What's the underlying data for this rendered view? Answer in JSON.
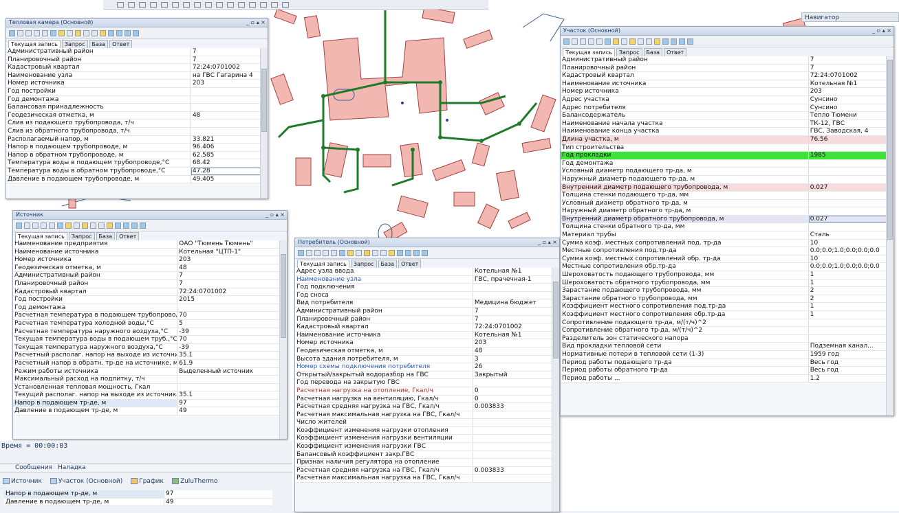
{
  "navigator_title": "Навигатор",
  "tabs": {
    "current": "Текущая запись",
    "query": "Запрос",
    "base": "База",
    "answer": "Ответ"
  },
  "win_controls": "_ ▫ ▴ ×",
  "heat_chamber": {
    "title": "Тепловая камера (Основной)",
    "rows": [
      [
        "Административный район",
        "7"
      ],
      [
        "Планировочный район",
        "7"
      ],
      [
        "Кадастровый квартал",
        "72:24:0701002"
      ],
      [
        "Наименование узла",
        "на ГВС Гагарина 4"
      ],
      [
        "Номер источника",
        "203"
      ],
      [
        "Год постройки",
        ""
      ],
      [
        "Год демонтажа",
        ""
      ],
      [
        "Балансовая принадлежность",
        ""
      ],
      [
        "Геодезическая отметка, м",
        "48"
      ],
      [
        "Слив из подающего трубопровода, т/ч",
        ""
      ],
      [
        "Слив из обратного трубопровода, т/ч",
        ""
      ],
      [
        "Располагаемый напор, м",
        "33.821"
      ],
      [
        "Напор в подающем трубопроводе, м",
        "96.406"
      ],
      [
        "Напор в обратном трубопроводе, м",
        "62.585"
      ],
      [
        "Температура воды в подающем трубопроводе,°С",
        "68.42"
      ],
      [
        "Температура воды в обратном трубопроводе,°С",
        "47.28"
      ],
      [
        "Давление в подающем трубопроводе, м",
        "49.405"
      ]
    ]
  },
  "source": {
    "title": "Источник",
    "rows": [
      [
        "Наименование предприятия",
        "ОАО \"Тюмень Тюмень\""
      ],
      [
        "Наименование источника",
        "Котельная \"ЦТП-1\""
      ],
      [
        "Номер источника",
        "203"
      ],
      [
        "Геодезическая отметка, м",
        "48"
      ],
      [
        "Административный район",
        "7"
      ],
      [
        "Планировочный район",
        "7"
      ],
      [
        "Кадастровый квартал",
        "72:24:0701002"
      ],
      [
        "Год постройки",
        "2015"
      ],
      [
        "Год демонтажа",
        ""
      ],
      [
        "Расчетная температура в подающем трубопроводе,°С",
        "70"
      ],
      [
        "Расчетная температура холодной воды,°С",
        "5"
      ],
      [
        "Расчетная температура наружного воздуха,°С",
        "-39"
      ],
      [
        "Текущая температура воды в подающем труб.,°С",
        "70"
      ],
      [
        "Текущая температура наружного воздуха,°С",
        "-39"
      ],
      [
        "Расчетный располаг. напор на выходе из источника, м",
        "35.1"
      ],
      [
        "Расчетный напор в обратн. тр-де на источнике, м",
        "61.9"
      ],
      [
        "Режим работы источника",
        "Выделенный источник"
      ],
      [
        "Максимальный расход на подпитку, т/ч",
        ""
      ],
      [
        "Установленная тепловая мощность, Гкал",
        ""
      ],
      [
        "Текущий располаг. напор на выходе из источника, м",
        "35.1"
      ],
      [
        "Напор в подающем тр-де, м",
        "97"
      ],
      [
        "Давление в подающем тр-де, м",
        "49"
      ]
    ]
  },
  "consumer": {
    "title": "Потребитель (Основной)",
    "rows": [
      [
        "Адрес узла ввода",
        "Котельная №1"
      ],
      [
        "Наименование узла",
        "ГВС, прачечная-1"
      ],
      [
        "Год подключения",
        ""
      ],
      [
        "Год сноса",
        ""
      ],
      [
        "Вид потребителя",
        "Медицина бюджет"
      ],
      [
        "Административный район",
        "7"
      ],
      [
        "Планировочный район",
        "7"
      ],
      [
        "Кадастровый квартал",
        "72:24:0701002"
      ],
      [
        "Наименование источника",
        "Котельная №1"
      ],
      [
        "Номер источника",
        "203"
      ],
      [
        "Геодезическая отметка, м",
        "48"
      ],
      [
        "Высота здания потребителя, м",
        "3"
      ],
      [
        "Номер схемы подключения потребителя",
        "26"
      ],
      [
        "Открытый/закрытый водоразбор на ГВС",
        "Закрытый"
      ],
      [
        "Год перевода на закрытую ГВС",
        ""
      ],
      [
        "Расчетная нагрузка на отопление, Гкал/ч",
        "0"
      ],
      [
        "Расчетная нагрузка на вентиляцию, Гкал/ч",
        "0"
      ],
      [
        "Расчетная средняя нагрузка на ГВС, Гкал/ч",
        "0.003833"
      ],
      [
        "Расчетная максимальная нагрузка на ГВС, Гкал/ч",
        ""
      ],
      [
        "Число жителей",
        ""
      ],
      [
        "Коэффициент изменения нагрузки отопления",
        ""
      ],
      [
        "Коэффициент изменения нагрузки вентиляции",
        ""
      ],
      [
        "Коэффициент изменения нагрузки ГВС",
        ""
      ],
      [
        "Балансовый коэффициент закр.ГВС",
        ""
      ],
      [
        "Признак наличия регулятора на отопление",
        ""
      ],
      [
        "Расчетная средняя нагрузка на ГВС, Гкал/ч",
        "0.003833"
      ],
      [
        "Расчетная максимальная нагрузка на ГВС, Гкал/ч",
        ""
      ]
    ]
  },
  "section": {
    "title": "Участок (Основной)",
    "rows": [
      [
        "Административный район",
        "7"
      ],
      [
        "Планировочный район",
        "7"
      ],
      [
        "Кадастровый квартал",
        "72:24:0701002"
      ],
      [
        "Наименование источника",
        "Котельная №1"
      ],
      [
        "Номер источника",
        "203"
      ],
      [
        "Адрес участка",
        "Сунсино"
      ],
      [
        "Адрес потребителя",
        "Сунсино"
      ],
      [
        "Балансодержатель",
        "Тепло Тюмени"
      ],
      [
        "Наименование начала участка",
        "ТК-12, ГВС"
      ],
      [
        "Наименование конца участка",
        "ГВС, Заводская, 4"
      ],
      [
        "Длина участка, м",
        "76.56"
      ],
      [
        "Тип строительства",
        ""
      ],
      [
        "Год прокладки",
        "1985"
      ],
      [
        "Год демонтажа",
        ""
      ],
      [
        "Условный диаметр подающего тр-да, м",
        ""
      ],
      [
        "Наружный диаметр подающего тр-да, м",
        ""
      ],
      [
        "Внутренний диаметр подающего трубопровода, м",
        "0.027"
      ],
      [
        "Толщина стенки подающего тр-да, мм",
        ""
      ],
      [
        "Условный диаметр обратного тр-да, м",
        ""
      ],
      [
        "Наружный диаметр обратного тр-да, м",
        ""
      ],
      [
        "Внутренний диаметр обратного трубопровода, м",
        "0.027"
      ],
      [
        "Толщина стенки обратного тр-да, мм",
        ""
      ],
      [
        "Материал трубы",
        "Сталь"
      ],
      [
        "Сумма коэф. местных сопротивлений под. тр-да",
        "10"
      ],
      [
        "Местные сопротивления под.тр-да",
        "0.0;0.0;1.0;0.0;0.0;0.0"
      ],
      [
        "Сумма коэф. местных сопротивлений обр. тр-да",
        "10"
      ],
      [
        "Местные сопротивления обр.тр-да",
        "0.0;0.0;1.0;0.0;0.0;0.0"
      ],
      [
        "Шероховатость подающего трубопровода, мм",
        "1"
      ],
      [
        "Шероховатость обратного трубопровода, мм",
        "1"
      ],
      [
        "Зарастание подающего трубопровода, мм",
        "2"
      ],
      [
        "Зарастание обратного трубопровода, мм",
        "2"
      ],
      [
        "Коэффициент местного сопротивления под.тр-да",
        "1"
      ],
      [
        "Коэффициент местного сопротивления обр.тр-да",
        "1"
      ],
      [
        "Сопротивление подающего тр-да, м/(т/ч)^2",
        ""
      ],
      [
        "Сопротивление обратного тр-да, м/(т/ч)^2",
        ""
      ],
      [
        "Разделитель зон статического напора",
        ""
      ],
      [
        "Вид прокладки тепловой сети",
        "Подземная канал..."
      ],
      [
        "Нормативные потери в тепловой сети (1-3)",
        "1959 год"
      ],
      [
        "Период работы подающего тр-да",
        "Весь год"
      ],
      [
        "Период работы обратного тр-да",
        "Весь год"
      ],
      [
        "Период работы ...",
        "1.2"
      ]
    ]
  },
  "bottom": {
    "time_label": "Время",
    "time_value": "00:00:03",
    "tab_messages": "Сообщения",
    "tab_debug": "Наладка",
    "task_source": "Источник",
    "task_section": "Участок (Основной)",
    "task_chart": "График",
    "task_zulu": "ZuluThermo",
    "rows": [
      [
        "Напор в подающем тр-де, м",
        "97"
      ],
      [
        "Давление в подающем тр-де, м",
        "49"
      ]
    ]
  }
}
